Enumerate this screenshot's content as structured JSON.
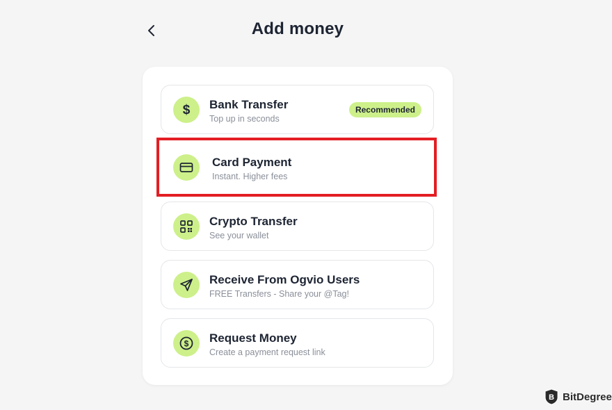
{
  "header": {
    "title": "Add money",
    "back_icon": "chevron-left-icon"
  },
  "options": [
    {
      "title": "Bank Transfer",
      "subtitle": "Top up in seconds",
      "badge": "Recommended",
      "icon": "dollar-icon"
    },
    {
      "title": "Card Payment",
      "subtitle": "Instant. Higher fees",
      "icon": "credit-card-icon",
      "highlighted": true
    },
    {
      "title": "Crypto Transfer",
      "subtitle": "See your wallet",
      "icon": "qr-code-icon"
    },
    {
      "title": "Receive From Ogvio Users",
      "subtitle": "FREE Transfers - Share your @Tag!",
      "icon": "send-icon"
    },
    {
      "title": "Request Money",
      "subtitle": "Create a payment request link",
      "icon": "dollar-circle-icon"
    }
  ],
  "watermark": {
    "text": "BitDegree",
    "icon": "bitdegree-logo-icon"
  },
  "colors": {
    "accent": "#cdf08a",
    "highlight_border": "#e31e24",
    "text": "#1d2432",
    "subtext": "#8a8f99"
  }
}
